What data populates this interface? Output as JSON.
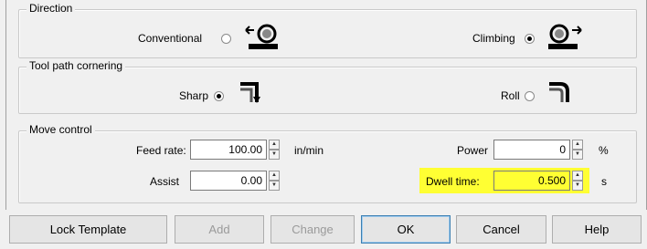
{
  "direction": {
    "legend": "Direction",
    "options": [
      {
        "label": "Conventional",
        "selected": false,
        "icon": "conventional-cut-icon"
      },
      {
        "label": "Climbing",
        "selected": true,
        "icon": "climbing-cut-icon"
      }
    ]
  },
  "cornering": {
    "legend": "Tool path cornering",
    "options": [
      {
        "label": "Sharp",
        "selected": true,
        "icon": "sharp-corner-icon"
      },
      {
        "label": "Roll",
        "selected": false,
        "icon": "roll-corner-icon"
      }
    ]
  },
  "move": {
    "legend": "Move control",
    "feed_rate": {
      "label": "Feed rate:",
      "value": "100.00",
      "unit": "in/min"
    },
    "assist": {
      "label": "Assist",
      "value": "0.00"
    },
    "power": {
      "label": "Power",
      "value": "0",
      "unit": "%"
    },
    "dwell": {
      "label": "Dwell time:",
      "value": "0.500",
      "unit": "s",
      "highlight_color": "#ffff33"
    }
  },
  "buttons": {
    "lock": "Lock Template",
    "add": "Add",
    "change": "Change",
    "ok": "OK",
    "cancel": "Cancel",
    "help": "Help"
  },
  "spinner_icons": {
    "up": "spin-up-icon",
    "down": "spin-down-icon"
  }
}
